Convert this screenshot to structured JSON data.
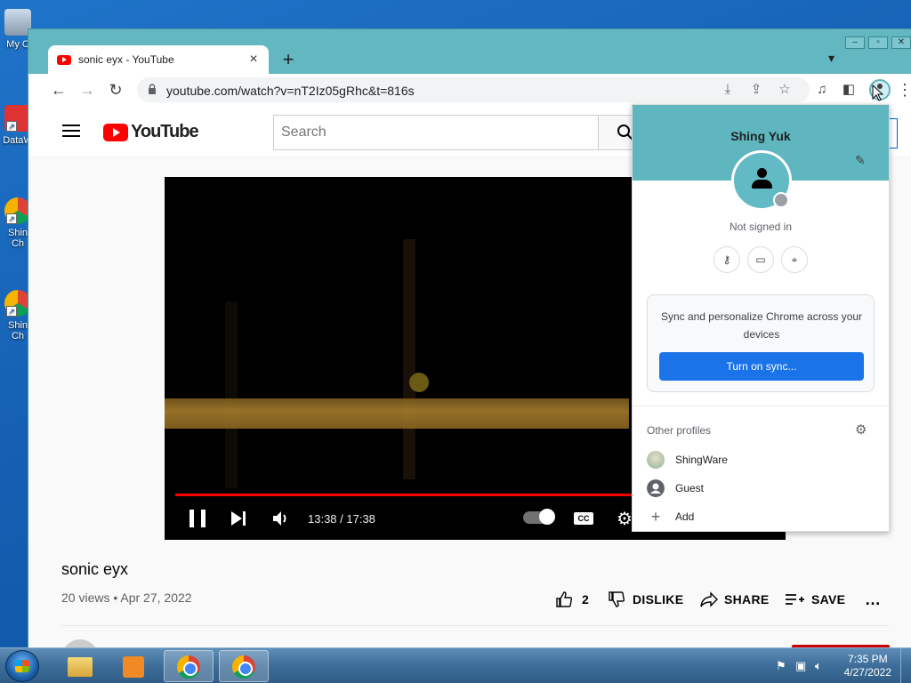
{
  "desktop": {
    "icons": [
      {
        "label": "My C"
      },
      {
        "label": "DataW"
      },
      {
        "label": "Shin\nCh"
      },
      {
        "label": "Shin\nCh"
      }
    ]
  },
  "browser": {
    "window_controls": {
      "minimize": "▭",
      "maximize": "▭",
      "close": "✕"
    },
    "tab": {
      "title": "sonic eyx - YouTube",
      "close": "×"
    },
    "new_tab": "+",
    "tab_search": "⌄",
    "url": "youtube.com/watch?v=nT2Iz05gRhc&t=816s"
  },
  "youtube": {
    "logo_text": "YouTube",
    "search_placeholder": "Search",
    "video": {
      "time": "13:38 / 17:38",
      "progress": 0.78,
      "title": "sonic eyx",
      "meta": "20 views • Apr 27, 2022"
    },
    "actions": {
      "like_count": "2",
      "dislike": "DISLIKE",
      "share": "SHARE",
      "save": "SAVE",
      "more": "…"
    }
  },
  "profile_menu": {
    "name": "Shing Yuk",
    "status": "Not signed in",
    "sync_text": "Sync and personalize Chrome across your devices",
    "sync_button": "Turn on sync...",
    "other_profiles_label": "Other profiles",
    "profiles": [
      {
        "name": "ShingWare",
        "icon": "avatar-image"
      },
      {
        "name": "Guest",
        "icon": "guest-icon"
      },
      {
        "name": "Add",
        "icon": "plus-icon"
      }
    ]
  },
  "taskbar": {
    "clock_time": "7:35 PM",
    "clock_date": "4/27/2022"
  }
}
